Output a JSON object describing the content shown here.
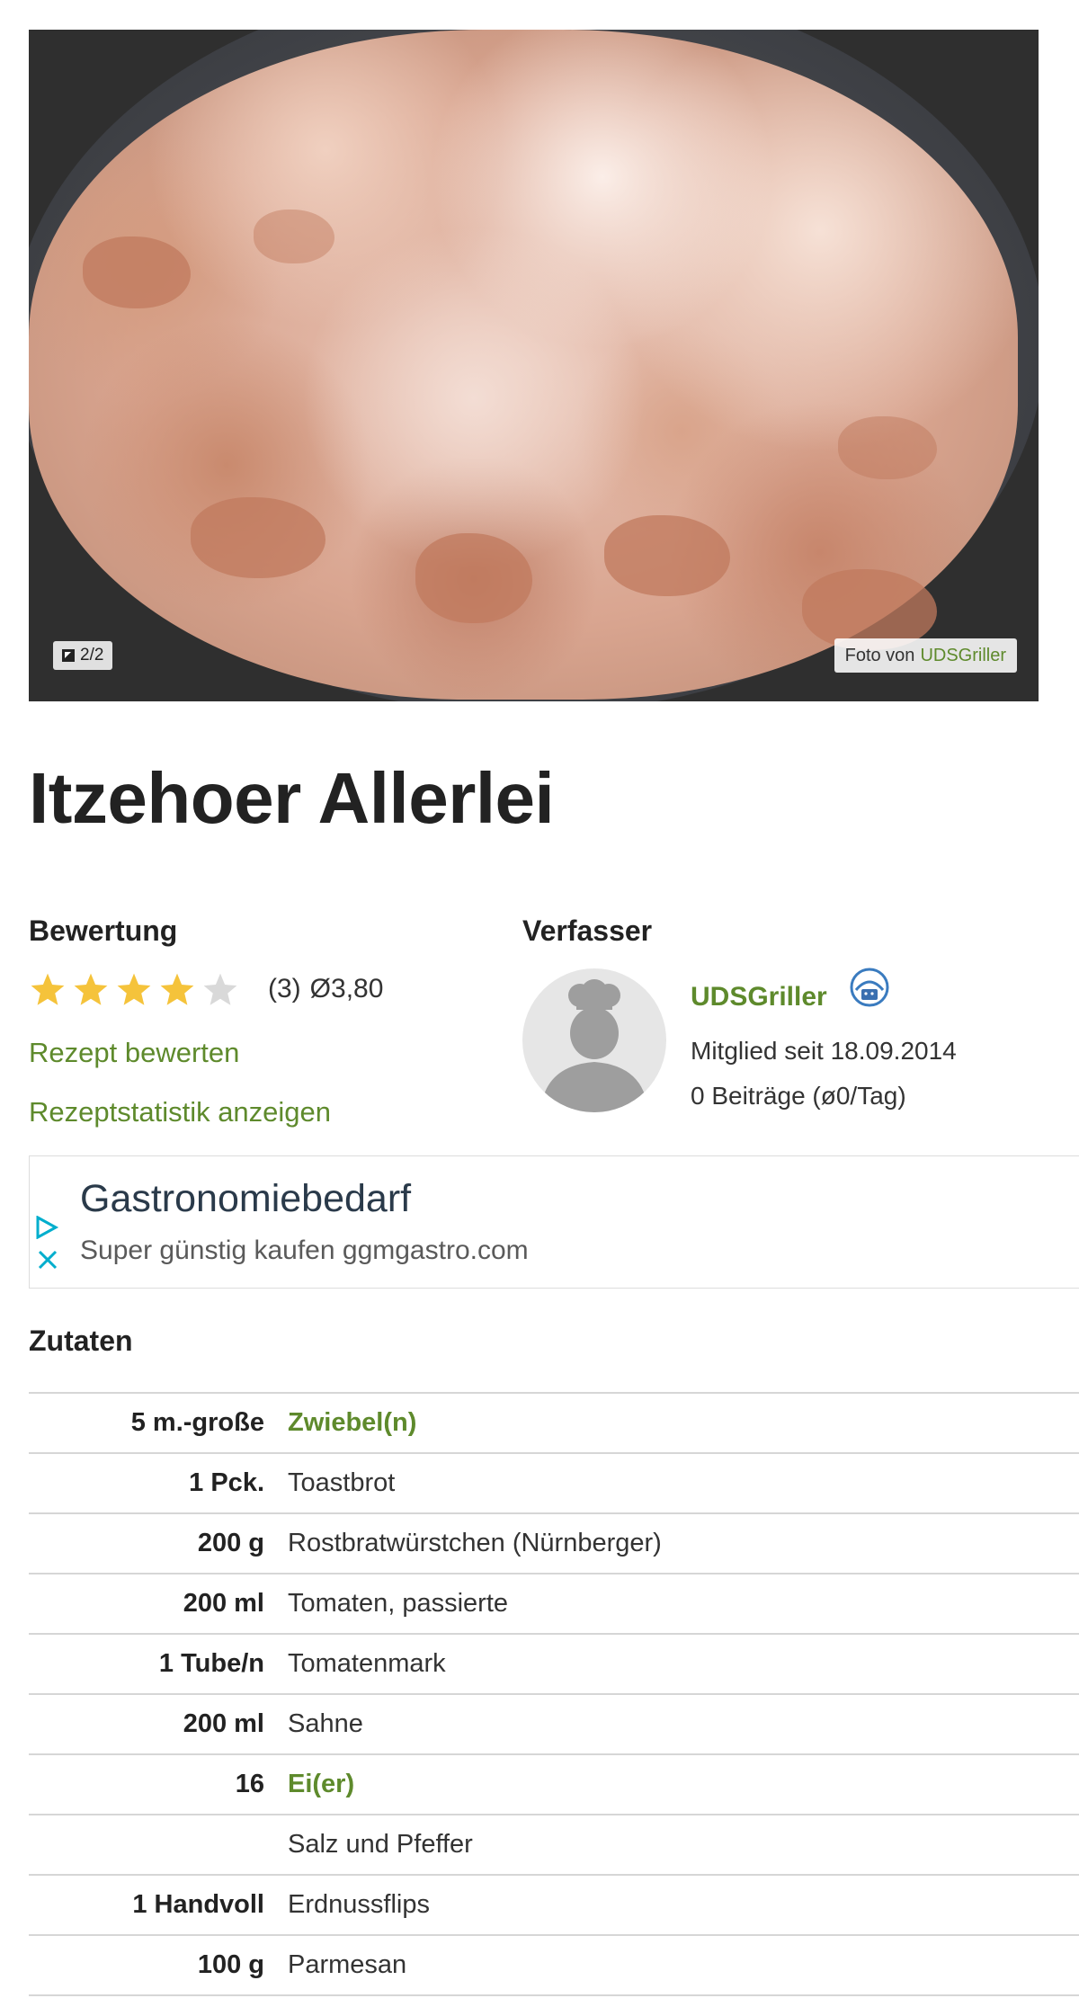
{
  "photo": {
    "counter": "2/2",
    "credit_prefix": "Foto von",
    "credit_author": "UDSGriller"
  },
  "recipe": {
    "title": "Itzehoer Allerlei"
  },
  "rating": {
    "label": "Bewertung",
    "stars_filled": 4,
    "stars_total": 5,
    "count": "(3)",
    "average": "Ø3,80",
    "rate_link": "Rezept bewerten",
    "stats_link": "Rezeptstatistik anzeigen"
  },
  "author": {
    "label": "Verfasser",
    "name": "UDSGriller",
    "member_since": "Mitglied seit 18.09.2014",
    "posts": "0 Beiträge (ø0/Tag)"
  },
  "ad": {
    "title": "Gastronomiebedarf",
    "description": "Super günstig kaufen",
    "url": "ggmgastro.com"
  },
  "ingredients": {
    "label": "Zutaten",
    "rows": [
      {
        "amount": "5 m.-große",
        "name": "Zwiebel(n)",
        "linked": true
      },
      {
        "amount": "1 Pck.",
        "name": "Toastbrot",
        "linked": false
      },
      {
        "amount": "200 g",
        "name": "Rostbratwürstchen (Nürnberger)",
        "linked": false
      },
      {
        "amount": "200 ml",
        "name": "Tomaten, passierte",
        "linked": false
      },
      {
        "amount": "1 Tube/n",
        "name": "Tomatenmark",
        "linked": false
      },
      {
        "amount": "200 ml",
        "name": "Sahne",
        "linked": false
      },
      {
        "amount": "16",
        "name": "Ei(er)",
        "linked": true
      },
      {
        "amount": "",
        "name": "Salz und Pfeffer",
        "linked": false
      },
      {
        "amount": "1 Handvoll",
        "name": "Erdnussflips",
        "linked": false
      },
      {
        "amount": "100 g",
        "name": "Parmesan",
        "linked": false
      }
    ]
  },
  "colors": {
    "accent_green": "#5e8a2c",
    "star_filled": "#f5c33b",
    "star_empty": "#d9d9d9",
    "ad_icon": "#00aecd"
  }
}
